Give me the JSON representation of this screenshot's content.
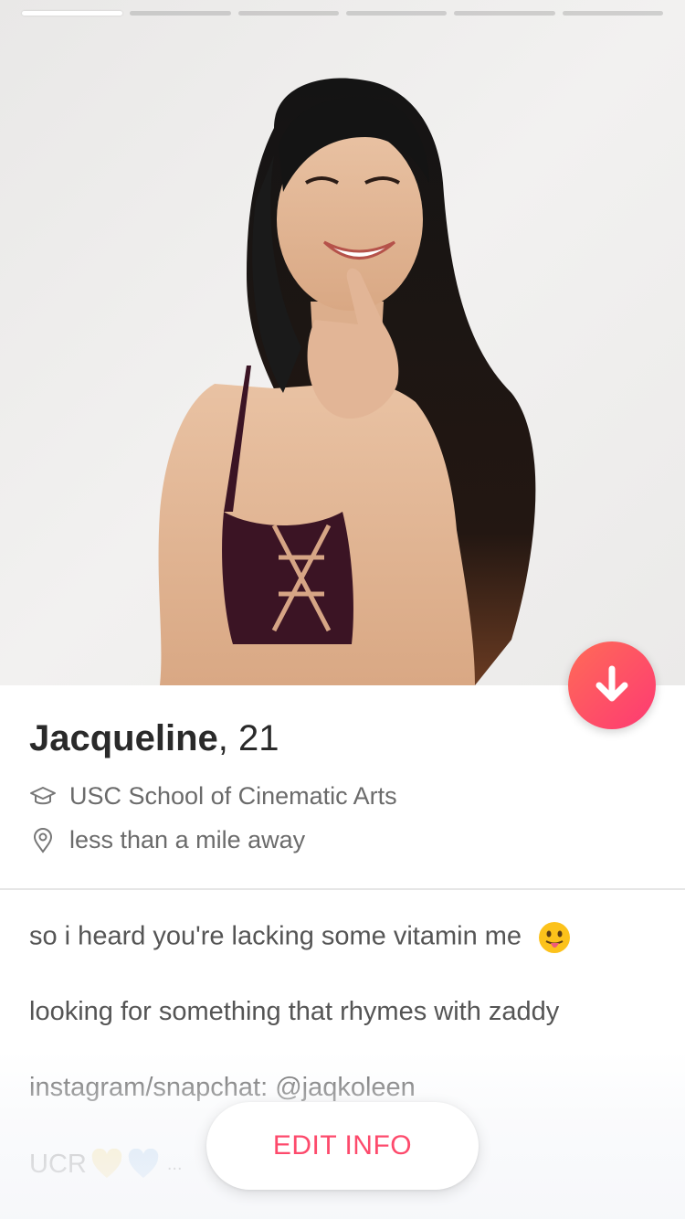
{
  "photo": {
    "progress_segments": 6,
    "active_segment": 1
  },
  "profile": {
    "name": "Jacqueline",
    "age_text": ", 21",
    "school": "USC School of Cinematic Arts",
    "distance": "less than a mile away"
  },
  "icons": {
    "school": "graduation-cap-icon",
    "distance": "location-pin-icon",
    "collapse": "arrow-down-icon"
  },
  "bio": {
    "line1": "so i heard you're lacking some vitamin me",
    "line2": "looking for something that rhymes with zaddy",
    "line3": "instagram/snapchat: @jaqkoleen",
    "line4": "UCR",
    "line4_suffix": "..."
  },
  "actions": {
    "edit_label": "EDIT INFO"
  },
  "colors": {
    "accent_start": "#ff6b57",
    "accent_end": "#fd3a73",
    "edit_text": "#fd4a6c"
  }
}
